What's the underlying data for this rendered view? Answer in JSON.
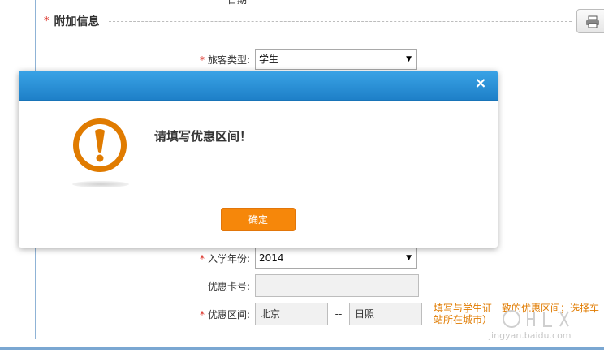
{
  "top_cut_text": "日期",
  "section": {
    "star": "*",
    "title": "附加信息"
  },
  "form": {
    "passenger_type": {
      "label": "旅客类型:",
      "value": "学生"
    },
    "enroll_year": {
      "label": "入学年份:",
      "value": "2014"
    },
    "discount_card": {
      "label": "优惠卡号:",
      "value": ""
    },
    "discount_range": {
      "label": "优惠区间:",
      "from": "北京",
      "separator": "--",
      "to": "日照"
    },
    "hint": "填写与学生证一致的优惠区间；选择车站所在城市）"
  },
  "dialog": {
    "close_label": "×",
    "message": "请填写优惠区间！",
    "confirm_label": "确定"
  },
  "colors": {
    "header_blue": "#1e80c8",
    "confirm_orange": "#f6870a",
    "icon_orange": "#e07b00",
    "required_red": "#d9261c"
  },
  "icons": [
    "warning-icon",
    "print-icon",
    "dropdown-arrow-icon",
    "close-icon"
  ],
  "watermark": "jingyan.baidu.com"
}
